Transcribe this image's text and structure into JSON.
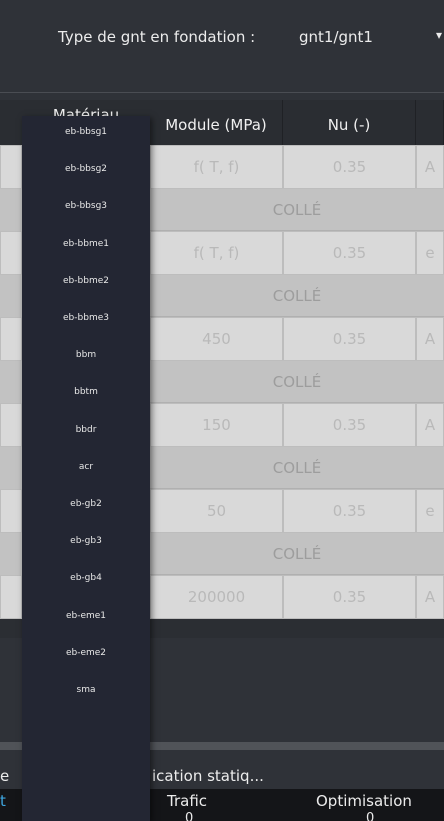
{
  "fondation": {
    "label": "Type de gnt en fondation :",
    "value": "gnt1/gnt1",
    "arrow": "▾"
  },
  "table": {
    "headers": {
      "materiau": "Matériau",
      "module": "Module (MPa)",
      "nu": "Nu (-)"
    },
    "rows": [
      {
        "type": "layer",
        "module": "f( T, f)",
        "nu": "0.35",
        "extra": "A"
      },
      {
        "type": "interface",
        "label": "COLLÉ"
      },
      {
        "type": "layer",
        "module": "f( T, f)",
        "nu": "0.35",
        "extra": "e"
      },
      {
        "type": "interface",
        "label": "COLLÉ"
      },
      {
        "type": "layer",
        "module": "450",
        "nu": "0.35",
        "extra": "A"
      },
      {
        "type": "interface",
        "label": "COLLÉ"
      },
      {
        "type": "layer",
        "module": "150",
        "nu": "0.35",
        "extra": "A"
      },
      {
        "type": "interface",
        "label": "COLLÉ"
      },
      {
        "type": "layer",
        "module": "50",
        "nu": "0.35",
        "extra": "e"
      },
      {
        "type": "interface",
        "label": "COLLÉ"
      },
      {
        "type": "layer",
        "module": "200000",
        "nu": "0.35",
        "extra": "A"
      }
    ]
  },
  "materiaux_dropdown": [
    "eb-bbsg1",
    "eb-bbsg2",
    "eb-bbsg3",
    "eb-bbme1",
    "eb-bbme2",
    "eb-bbme3",
    "bbm",
    "bbtm",
    "bbdr",
    "acr",
    "eb-gb2",
    "eb-gb3",
    "eb-gb4",
    "eb-eme1",
    "eb-eme2",
    "sma"
  ],
  "bottom": {
    "verification_prefix": "e",
    "verification": "ication statiq...",
    "tabs": {
      "first_fragment": "t",
      "trafic": "Trafic",
      "optimisation": "Optimisation",
      "trafic_sub": "0",
      "optimisation_sub": "0"
    }
  },
  "colors": {
    "background": "#2f3238",
    "dropdown": "#232633",
    "cell": "#d9d9d9",
    "interface": "#c2c2c2",
    "accent": "#3ea6e0"
  }
}
